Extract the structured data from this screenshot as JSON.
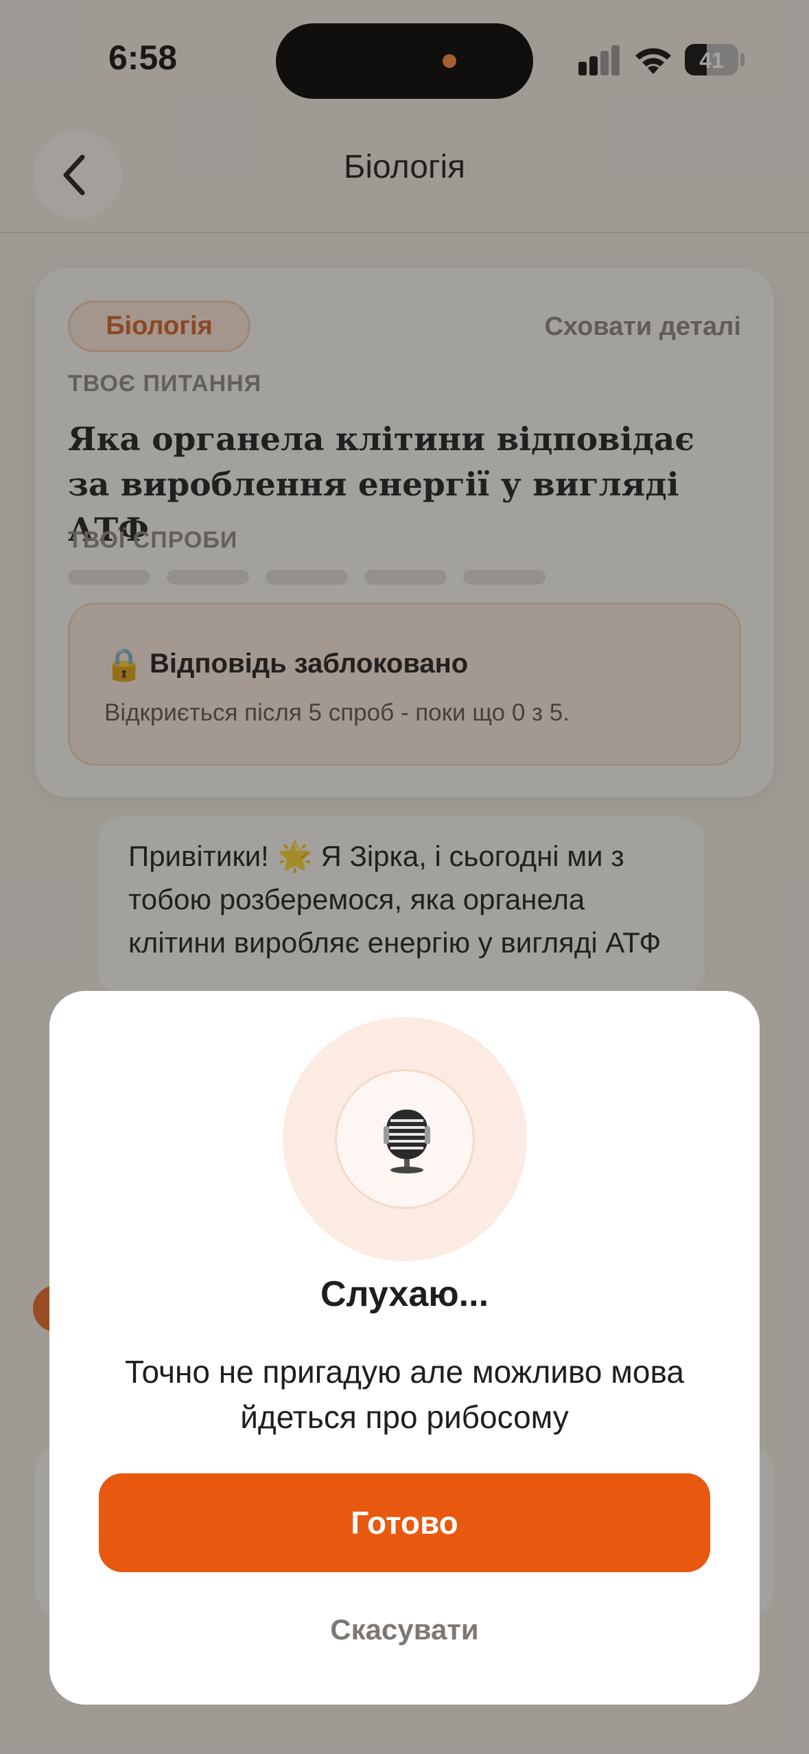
{
  "status_bar": {
    "time": "6:58",
    "battery_level": "41",
    "battery_fraction": 0.41
  },
  "header": {
    "title": "Біологія"
  },
  "question_card": {
    "subject_badge": "Біологія",
    "hide_details": "Сховати деталі",
    "question_label": "ТВОЄ ПИТАННЯ",
    "question": "Яка органела клітини відповідає за вироблення енергії у вигляді АТФ",
    "attempts_label": "ТВОЇ СПРОБИ",
    "attempts_used": 0,
    "attempts_total": 5,
    "locked_title": "Відповідь заблоковано",
    "locked_note": "Відкриється після 5 спроб - поки що 0 з 5."
  },
  "chat": {
    "message": "Привітики! 🌟 Я Зірка, і сьогодні ми з тобою розберемося, яка органела клітини виробляє енергію у вигляді АТФ"
  },
  "voice_modal": {
    "title": "Слухаю...",
    "transcript": "Точно не пригадую але можливо мова йдеться про рибосому",
    "done_label": "Готово",
    "cancel_label": "Скасувати"
  },
  "colors": {
    "accent": "#e8580f",
    "badge_text": "#d4612a",
    "background": "#f4efe9",
    "overlay": "rgba(40,35,30,0.42)"
  },
  "icons": [
    "back-chevron-icon",
    "lock-icon",
    "microphone-icon",
    "signal-icon",
    "wifi-icon",
    "battery-icon"
  ]
}
